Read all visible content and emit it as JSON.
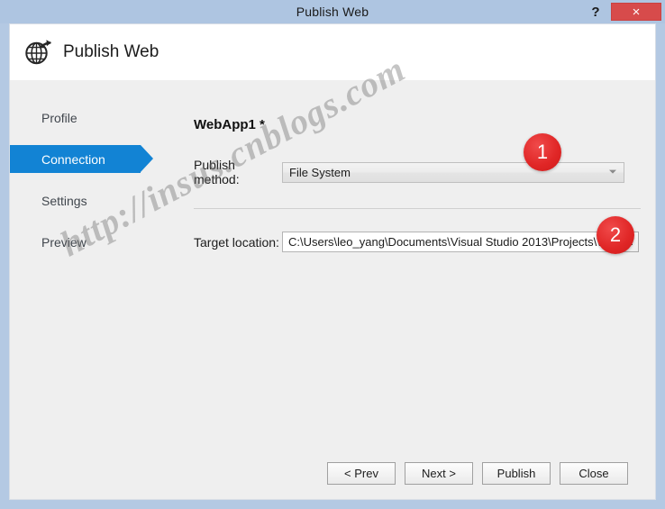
{
  "window": {
    "title": "Publish Web",
    "help_label": "?",
    "close_label": "×"
  },
  "header": {
    "title": "Publish Web",
    "icon": "globe-publish-icon"
  },
  "sidebar": {
    "items": [
      {
        "label": "Profile",
        "selected": false
      },
      {
        "label": "Connection",
        "selected": true
      },
      {
        "label": "Settings",
        "selected": false
      },
      {
        "label": "Preview",
        "selected": false
      }
    ]
  },
  "main": {
    "app_title": "WebApp1 *",
    "publish_method": {
      "label": "Publish method:",
      "value": "File System",
      "arrow_icon": "chevron-down-icon"
    },
    "target_location": {
      "label": "Target location:",
      "value": "C:\\Users\\leo_yang\\Documents\\Visual Studio 2013\\Projects\\WebApp1",
      "browse_label": "..."
    }
  },
  "annotations": [
    {
      "number": "1",
      "target": "publish-method-dropdown"
    },
    {
      "number": "2",
      "target": "target-location-browse-button"
    }
  ],
  "footer": {
    "buttons": [
      {
        "label": "< Prev"
      },
      {
        "label": "Next >"
      },
      {
        "label": "Publish"
      },
      {
        "label": "Close"
      }
    ]
  },
  "watermark": {
    "text": "http://insus.cnblogs.com"
  },
  "colors": {
    "titlebar": "#aec5e1",
    "accent_blue": "#1283d4",
    "close_red": "#d74b4b",
    "badge_red": "#e02626",
    "body_gray": "#efefef"
  }
}
